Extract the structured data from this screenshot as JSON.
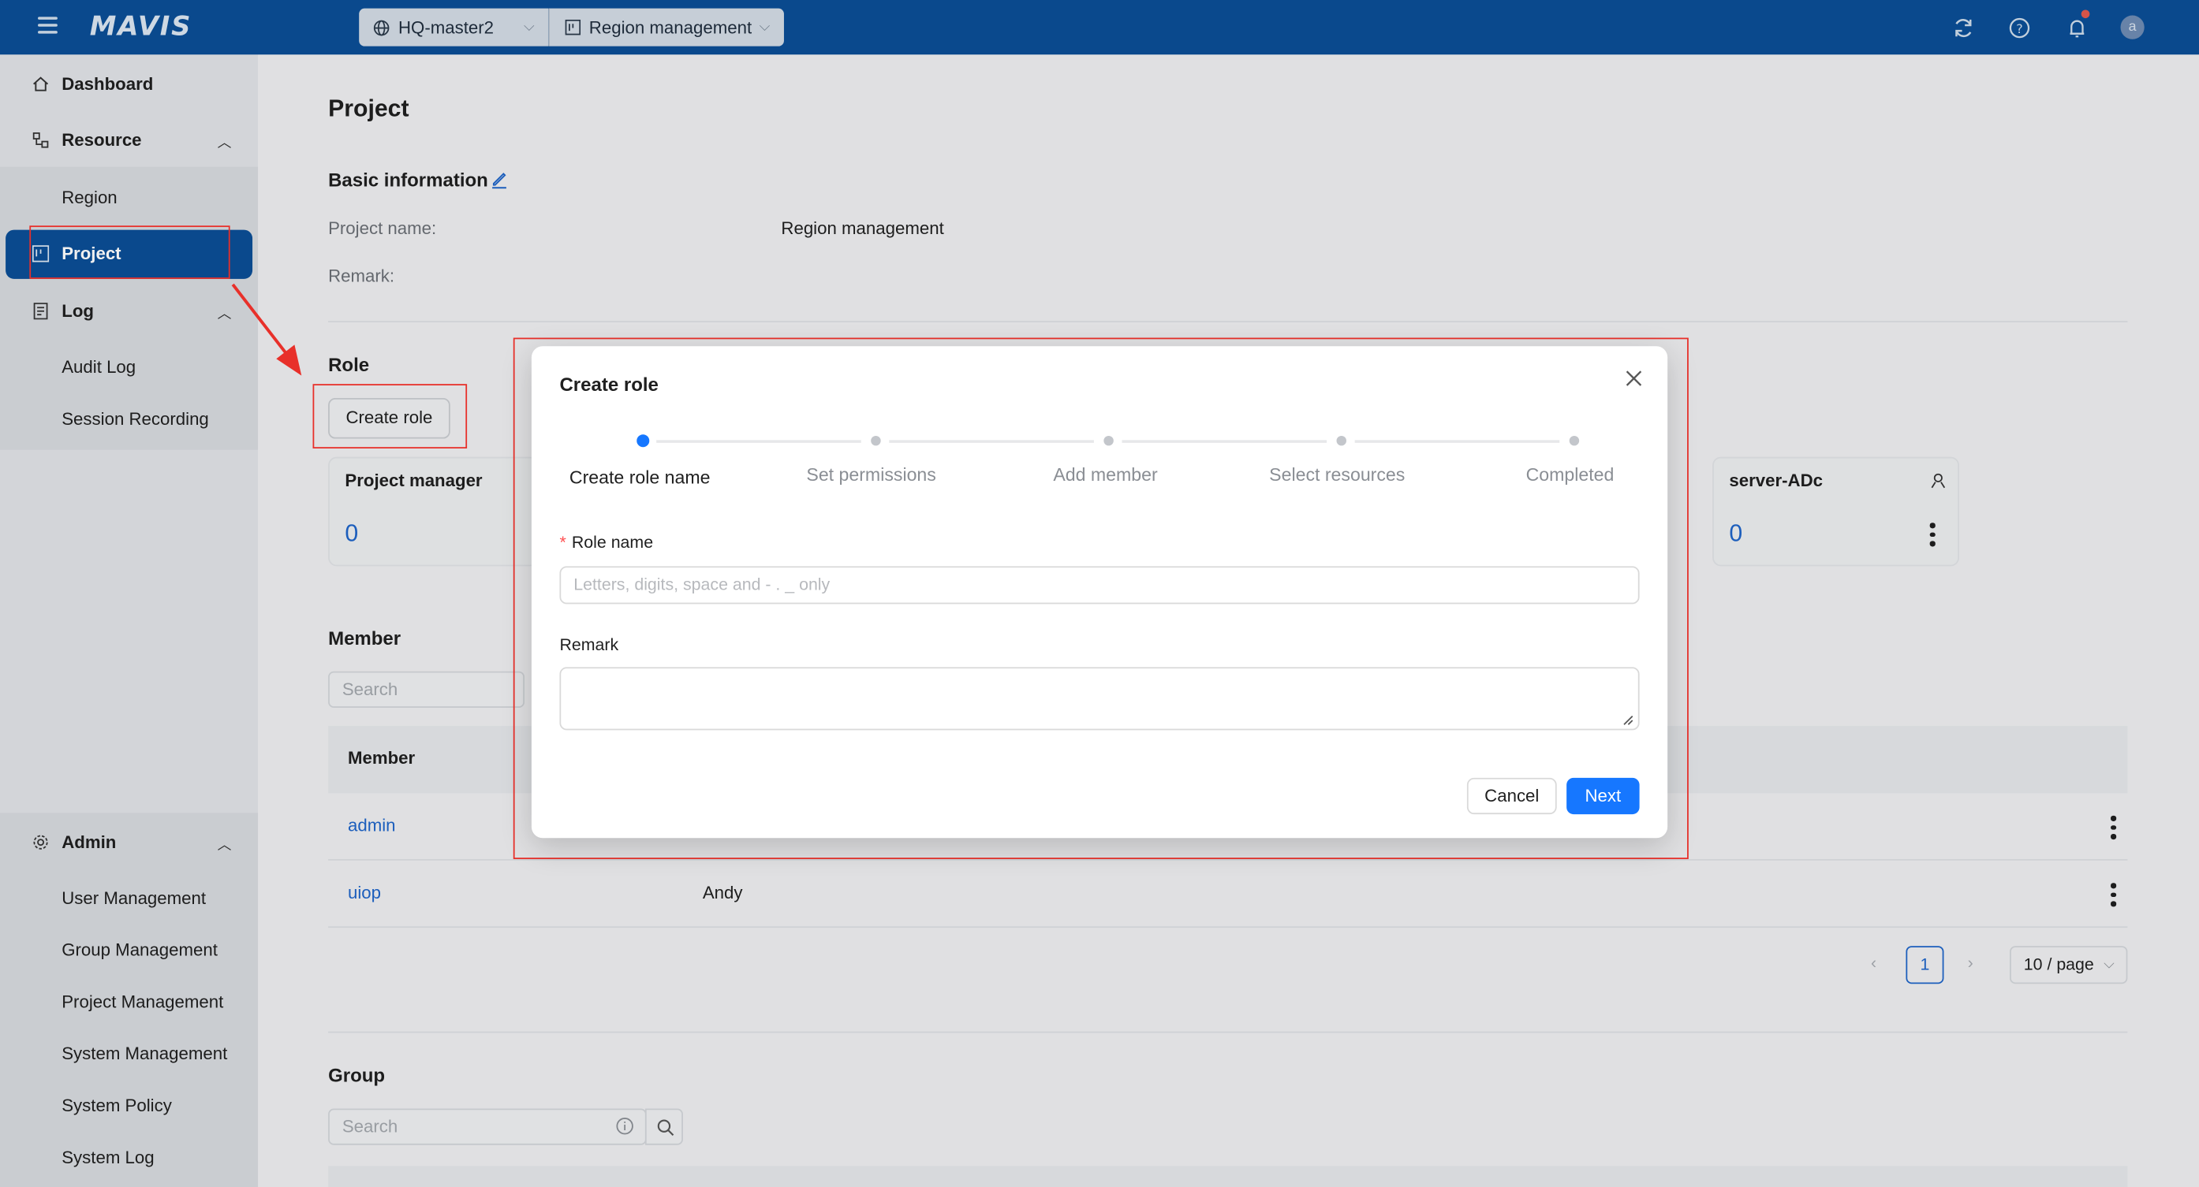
{
  "topbar": {
    "logo": "MAVIS",
    "cluster": "HQ-master2",
    "project": "Region management",
    "avatar_letter": "a"
  },
  "sidebar": {
    "dashboard": "Dashboard",
    "resource": "Resource",
    "region": "Region",
    "project": "Project",
    "log": "Log",
    "audit_log": "Audit Log",
    "session_recording": "Session Recording",
    "admin": "Admin",
    "admin_items": [
      "User Management",
      "Group Management",
      "Project Management",
      "System Management",
      "System Policy",
      "System Log"
    ]
  },
  "page": {
    "title": "Project",
    "basic_info": "Basic information",
    "project_name_label": "Project name:",
    "project_name_value": "Region management",
    "remark_label": "Remark:",
    "role_section": "Role",
    "create_role_button": "Create role",
    "role_cards": [
      {
        "title": "Project manager",
        "count": "0"
      },
      {
        "title": "server-ADc",
        "count": "0"
      }
    ],
    "member_section": "Member",
    "member_search_placeholder": "Search",
    "member_table": {
      "header": "Member",
      "rows": [
        {
          "member": "admin",
          "name": ""
        },
        {
          "member": "uiop",
          "name": "Andy"
        }
      ]
    },
    "pagination": {
      "page": "1",
      "page_size": "10 / page"
    },
    "group_section": "Group",
    "group_search_placeholder": "Search"
  },
  "modal": {
    "title": "Create role",
    "steps": [
      "Create role name",
      "Set permissions",
      "Add member",
      "Select resources",
      "Completed"
    ],
    "active_step": 0,
    "role_name_label": "Role name",
    "role_name_placeholder": "Letters, digits, space and - . _ only",
    "remark_label": "Remark",
    "cancel": "Cancel",
    "next": "Next"
  },
  "colors": {
    "topbar": "#0b4e96",
    "primary": "#1677ff",
    "link": "#1e64c8",
    "annotation": "#e8302a"
  }
}
